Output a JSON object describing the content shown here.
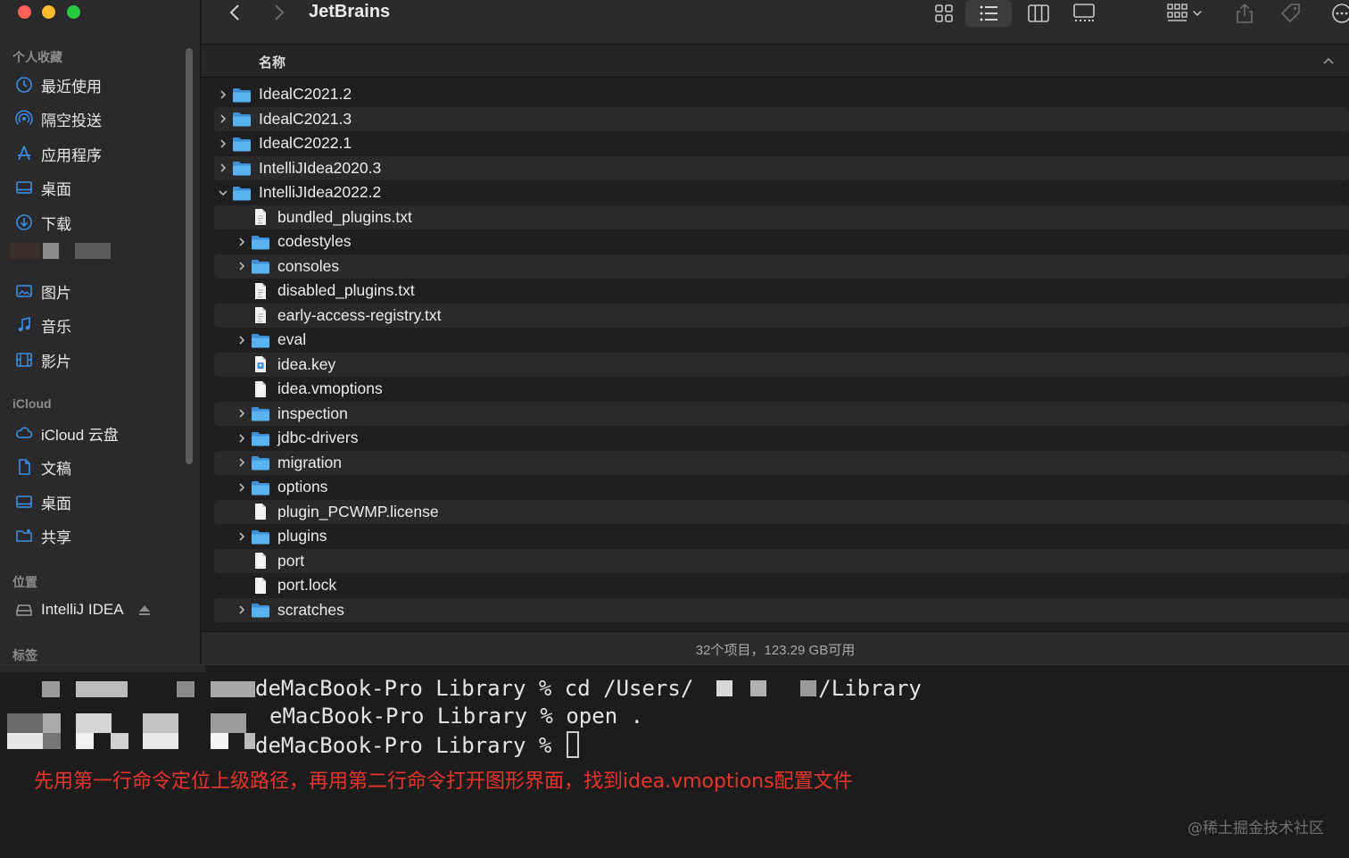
{
  "window": {
    "title": "JetBrains"
  },
  "sidebar": {
    "favorites_heading": "个人收藏",
    "favorites": [
      {
        "label": "最近使用",
        "icon": "clock-icon"
      },
      {
        "label": "隔空投送",
        "icon": "airdrop-icon"
      },
      {
        "label": "应用程序",
        "icon": "applications-icon"
      },
      {
        "label": "桌面",
        "icon": "desktop-icon"
      },
      {
        "label": "下载",
        "icon": "download-icon"
      },
      {
        "label": "图片",
        "icon": "photos-icon"
      },
      {
        "label": "音乐",
        "icon": "music-icon"
      },
      {
        "label": "影片",
        "icon": "movies-icon"
      }
    ],
    "icloud_heading": "iCloud",
    "icloud": [
      {
        "label": "iCloud 云盘",
        "icon": "cloud-icon"
      },
      {
        "label": "文稿",
        "icon": "document-icon"
      },
      {
        "label": "桌面",
        "icon": "desktop-icon"
      },
      {
        "label": "共享",
        "icon": "shared-folder-icon"
      }
    ],
    "locations_heading": "位置",
    "locations": [
      {
        "label": "IntelliJ IDEA",
        "icon": "disk-icon"
      }
    ],
    "tags_heading": "标签"
  },
  "list": {
    "column_name": "名称",
    "rows": [
      {
        "name": "IdealC2021.2",
        "kind": "folder",
        "level": 0,
        "expander": "collapsed"
      },
      {
        "name": "IdealC2021.3",
        "kind": "folder",
        "level": 0,
        "expander": "collapsed"
      },
      {
        "name": "IdealC2022.1",
        "kind": "folder",
        "level": 0,
        "expander": "collapsed"
      },
      {
        "name": "IntelliJIdea2020.3",
        "kind": "folder",
        "level": 0,
        "expander": "collapsed"
      },
      {
        "name": "IntelliJIdea2022.2",
        "kind": "folder",
        "level": 0,
        "expander": "expanded"
      },
      {
        "name": "bundled_plugins.txt",
        "kind": "txt",
        "level": 1,
        "expander": "none"
      },
      {
        "name": "codestyles",
        "kind": "folder",
        "level": 1,
        "expander": "collapsed"
      },
      {
        "name": "consoles",
        "kind": "folder",
        "level": 1,
        "expander": "collapsed"
      },
      {
        "name": "disabled_plugins.txt",
        "kind": "txt",
        "level": 1,
        "expander": "none"
      },
      {
        "name": "early-access-registry.txt",
        "kind": "txt",
        "level": 1,
        "expander": "none"
      },
      {
        "name": "eval",
        "kind": "folder",
        "level": 1,
        "expander": "collapsed"
      },
      {
        "name": "idea.key",
        "kind": "key",
        "level": 1,
        "expander": "none"
      },
      {
        "name": "idea.vmoptions",
        "kind": "file",
        "level": 1,
        "expander": "none"
      },
      {
        "name": "inspection",
        "kind": "folder",
        "level": 1,
        "expander": "collapsed"
      },
      {
        "name": "jdbc-drivers",
        "kind": "folder",
        "level": 1,
        "expander": "collapsed"
      },
      {
        "name": "migration",
        "kind": "folder",
        "level": 1,
        "expander": "collapsed"
      },
      {
        "name": "options",
        "kind": "folder",
        "level": 1,
        "expander": "collapsed"
      },
      {
        "name": "plugin_PCWMP.license",
        "kind": "file",
        "level": 1,
        "expander": "none"
      },
      {
        "name": "plugins",
        "kind": "folder",
        "level": 1,
        "expander": "collapsed"
      },
      {
        "name": "port",
        "kind": "file",
        "level": 1,
        "expander": "none"
      },
      {
        "name": "port.lock",
        "kind": "file",
        "level": 1,
        "expander": "none"
      },
      {
        "name": "scratches",
        "kind": "folder",
        "level": 1,
        "expander": "collapsed"
      }
    ]
  },
  "status": {
    "text": "32个项目，123.29 GB可用"
  },
  "terminal": {
    "line1_prompt": "deMacBook-Pro Library % ",
    "line1_cmd": "cd /Users/",
    "line1_suffix": "/Library",
    "line2_prompt": "eMacBook-Pro Library % ",
    "line2_cmd": "open .",
    "line3_prompt": "deMacBook-Pro Library % ",
    "annotation": "先用第一行命令定位上级路径，再用第二行命令打开图形界面，找到idea.vmoptions配置文件",
    "watermark": "@稀土掘金技术社区"
  },
  "colors": {
    "folder": "#4aa5e8",
    "accent": "#3a8ee6",
    "annotation": "#e8352c",
    "traffic_close": "#ff5f57",
    "traffic_min": "#febc2e",
    "traffic_max": "#28c840"
  }
}
